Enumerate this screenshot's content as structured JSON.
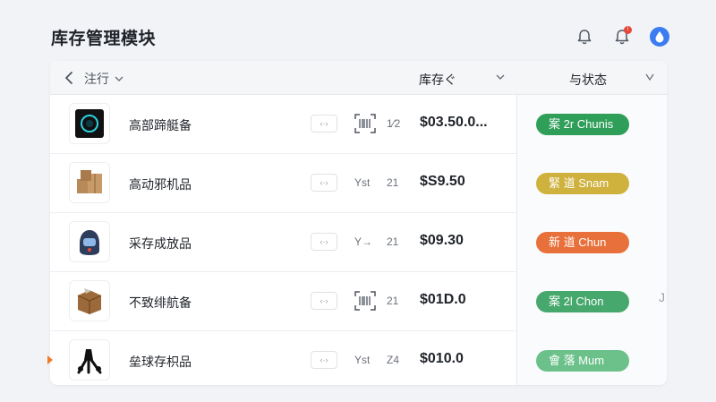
{
  "page": {
    "title": "库存管理模块"
  },
  "header": {
    "filter_label": "注行",
    "stock_label": "库存ぐ",
    "status_label": "与状态"
  },
  "colors": {
    "green": "#2f9e58",
    "yellow": "#cfb13e",
    "orange": "#e8703a",
    "green_light": "#56b47a",
    "accent": "#3b7cf0"
  },
  "rows": [
    {
      "name": "高部蹄艇备",
      "code_label": "‹·›",
      "sku": "",
      "qty": "1⁄2",
      "price": "$03.50.0...",
      "status": "案 2r Chunis",
      "status_color": "#2f9e58",
      "thumb_icon": "camera-device-icon",
      "mark": ""
    },
    {
      "name": "高动邪机品",
      "code_label": "‹·›",
      "sku": "Yst",
      "qty": "21",
      "price": "$S9.50",
      "status": "緊 道 Snam",
      "status_color": "#cfb13e",
      "thumb_icon": "cardboard-boxes-icon",
      "mark": ""
    },
    {
      "name": "采存成放品",
      "code_label": "‹·›",
      "sku": "Y→",
      "qty": "21",
      "price": "$09.30",
      "status": "新 道 Chun",
      "status_color": "#e8703a",
      "thumb_icon": "helmet-icon",
      "mark": ""
    },
    {
      "name": "不致绯航备",
      "code_label": "‹·›",
      "sku": "",
      "qty": "21",
      "price": "$01D.0",
      "status": "案 2l Chon",
      "status_color": "#46a86c",
      "thumb_icon": "package-box-icon",
      "mark": "J"
    },
    {
      "name": "垒球存枳品",
      "code_label": "‹·›",
      "sku": "Yst",
      "qty": "Z4",
      "price": "$010.0",
      "status": "會 落 Mum",
      "status_color": "#6cc08a",
      "thumb_icon": "tripod-icon",
      "mark": ""
    }
  ]
}
